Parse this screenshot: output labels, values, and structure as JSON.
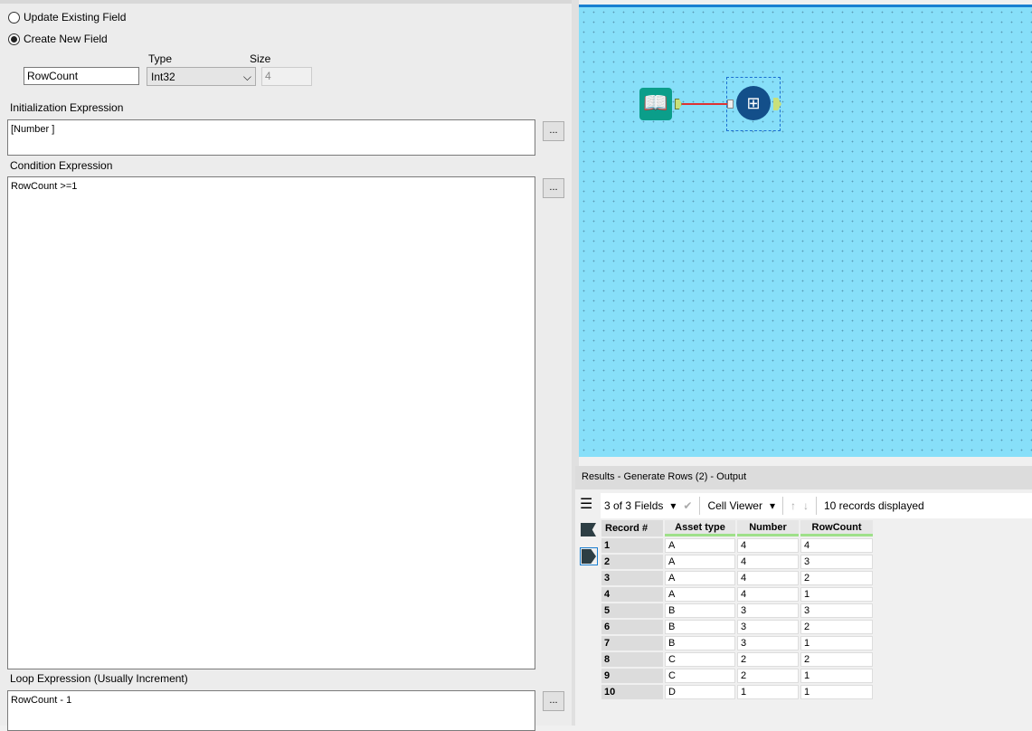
{
  "config": {
    "update_existing_label": "Update Existing Field",
    "create_new_label": "Create New  Field",
    "field_name": "RowCount",
    "type_label": "Type",
    "type_value": "Int32",
    "size_label": "Size",
    "size_value": "4",
    "init_label": "Initialization Expression",
    "init_value": "[Number ]",
    "condition_label": "Condition Expression",
    "condition_value": "RowCount >=1",
    "loop_label": "Loop Expression (Usually Increment)",
    "loop_value": "RowCount - 1",
    "ellipsis": "..."
  },
  "results": {
    "title": "Results - Generate Rows (2) - Output",
    "fields": "3 of 3 Fields",
    "viewer": "Cell Viewer",
    "records": "10 records displayed",
    "columns": [
      "Record #",
      "Asset type",
      "Number",
      "RowCount"
    ],
    "rows": [
      [
        "1",
        "A",
        "4",
        "4"
      ],
      [
        "2",
        "A",
        "4",
        "3"
      ],
      [
        "3",
        "A",
        "4",
        "2"
      ],
      [
        "4",
        "A",
        "4",
        "1"
      ],
      [
        "5",
        "B",
        "3",
        "3"
      ],
      [
        "6",
        "B",
        "3",
        "2"
      ],
      [
        "7",
        "B",
        "3",
        "1"
      ],
      [
        "8",
        "C",
        "2",
        "2"
      ],
      [
        "9",
        "C",
        "2",
        "1"
      ],
      [
        "10",
        "D",
        "1",
        "1"
      ]
    ]
  }
}
